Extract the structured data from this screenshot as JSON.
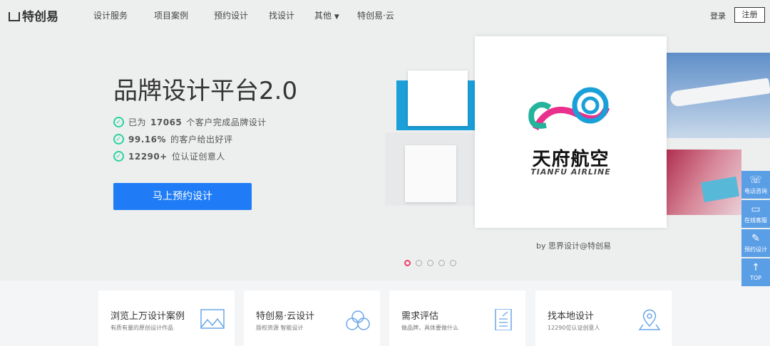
{
  "nav": {
    "logo": "特创易",
    "items": [
      "设计服务",
      "项目案例",
      "预约设计",
      "找设计",
      "其他",
      "特创易·云"
    ],
    "login": "登录",
    "register": "注册"
  },
  "hero": {
    "title": "品牌设计平台2.0",
    "features": [
      {
        "pre": "已为",
        "num": "17065",
        "post": " 个客户完成品牌设计"
      },
      {
        "pre": "",
        "num": "99.16%",
        "post": " 的客户给出好评"
      },
      {
        "pre": "",
        "num": "12290+",
        "post": " 位认证创意人"
      }
    ],
    "cta": "马上预约设计",
    "showcase": {
      "brand_cn": "天府航空",
      "brand_en": "TIANFU AIRLINE",
      "credit": "by 思界设计@特创易"
    },
    "carousel": {
      "count": 5,
      "active": 0
    }
  },
  "cards": [
    {
      "title": "浏览上万设计案例",
      "sub": "有质有量的原创设计作品",
      "icon": "image-icon"
    },
    {
      "title": "特创易·云设计",
      "sub": "版权资源 智能设计",
      "icon": "cloud-icon"
    },
    {
      "title": "需求评估",
      "sub": "做品牌，具体要做什么",
      "icon": "document-icon"
    },
    {
      "title": "找本地设计",
      "sub": "12290位认证创意人",
      "icon": "location-icon"
    }
  ],
  "sidebar": [
    {
      "label": "电话咨询",
      "icon": "phone-icon"
    },
    {
      "label": "在线客服",
      "icon": "chat-icon"
    },
    {
      "label": "预约设计",
      "icon": "edit-icon"
    },
    {
      "label": "TOP",
      "icon": "arrow-up-icon"
    }
  ],
  "colors": {
    "accent": "#1f7cf6",
    "check": "#2bd3a0",
    "side": "#5a9ee6",
    "dot_active": "#f03c6c"
  }
}
